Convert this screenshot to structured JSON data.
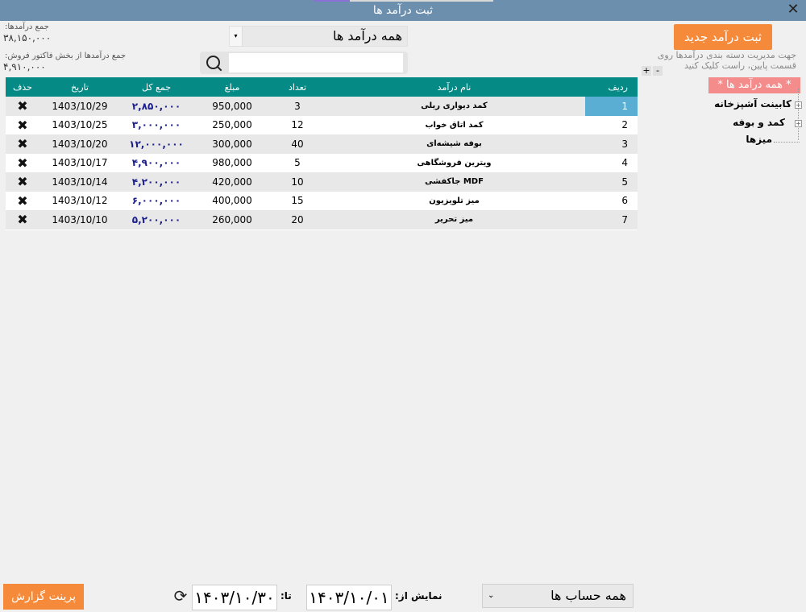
{
  "window": {
    "title": "ثبت درآمد ها",
    "close_icon": "close-icon"
  },
  "summary": {
    "total_label": "جمع درآمدها:",
    "total_value": "۳۸,۱۵۰,۰۰۰",
    "sales_label": "جمع درآمدها از بخش فاکتور فروش:",
    "sales_value": "۴,۹۱۰,۰۰۰"
  },
  "filter": {
    "category_selected": "همه درآمد ها",
    "search_placeholder": ""
  },
  "table": {
    "headers": {
      "del": "حذف",
      "date": "تاریخ",
      "total": "جمع کل",
      "amount": "مبلغ",
      "qty": "تعداد",
      "name": "نام درآمد",
      "idx": "ردیف"
    },
    "rows": [
      {
        "idx": "1",
        "name": "کمد دیواری ریلی",
        "qty": "3",
        "amount": "950,000",
        "total": "۲,۸۵۰,۰۰۰",
        "date": "1403/10/29"
      },
      {
        "idx": "2",
        "name": "کمد اتاق خواب",
        "qty": "12",
        "amount": "250,000",
        "total": "۳,۰۰۰,۰۰۰",
        "date": "1403/10/25"
      },
      {
        "idx": "3",
        "name": "بوفه شیشه‌ای",
        "qty": "40",
        "amount": "300,000",
        "total": "۱۲,۰۰۰,۰۰۰",
        "date": "1403/10/20"
      },
      {
        "idx": "4",
        "name": "ویترین فروشگاهی",
        "qty": "5",
        "amount": "980,000",
        "total": "۴,۹۰۰,۰۰۰",
        "date": "1403/10/17"
      },
      {
        "idx": "5",
        "name": "جاکفشی MDF",
        "qty": "10",
        "amount": "420,000",
        "total": "۴,۲۰۰,۰۰۰",
        "date": "1403/10/14"
      },
      {
        "idx": "6",
        "name": "میز تلویزیون",
        "qty": "15",
        "amount": "400,000",
        "total": "۶,۰۰۰,۰۰۰",
        "date": "1403/10/12"
      },
      {
        "idx": "7",
        "name": "میز تحریر",
        "qty": "20",
        "amount": "260,000",
        "total": "۵,۲۰۰,۰۰۰",
        "date": "1403/10/10"
      }
    ]
  },
  "sidebar": {
    "new_button": "ثبت درآمد جدید",
    "hint": "جهت مدیریت دسته بندی درآمدها روی قسمت پایین، راست کلیک کنید",
    "plus": "+",
    "minus": "-",
    "tree_all": "* همه درآمد ها *",
    "tree_items": [
      "کابینت آشپزخانه",
      "کمد و بوفه",
      "میزها"
    ]
  },
  "footer": {
    "print_button": "پرینت گزارش",
    "to_label": "تا:",
    "from_label": "نمایش از:",
    "to_date": "۱۴۰۳/۱۰/۳۰",
    "from_date": "۱۴۰۳/۱۰/۰۱",
    "account_selected": "همه حساب ها"
  },
  "colors": {
    "header_teal": "#058a85",
    "orange_button": "#f58a3a",
    "title_bar": "#6d8fae",
    "selected_cell": "#5aaed3"
  }
}
